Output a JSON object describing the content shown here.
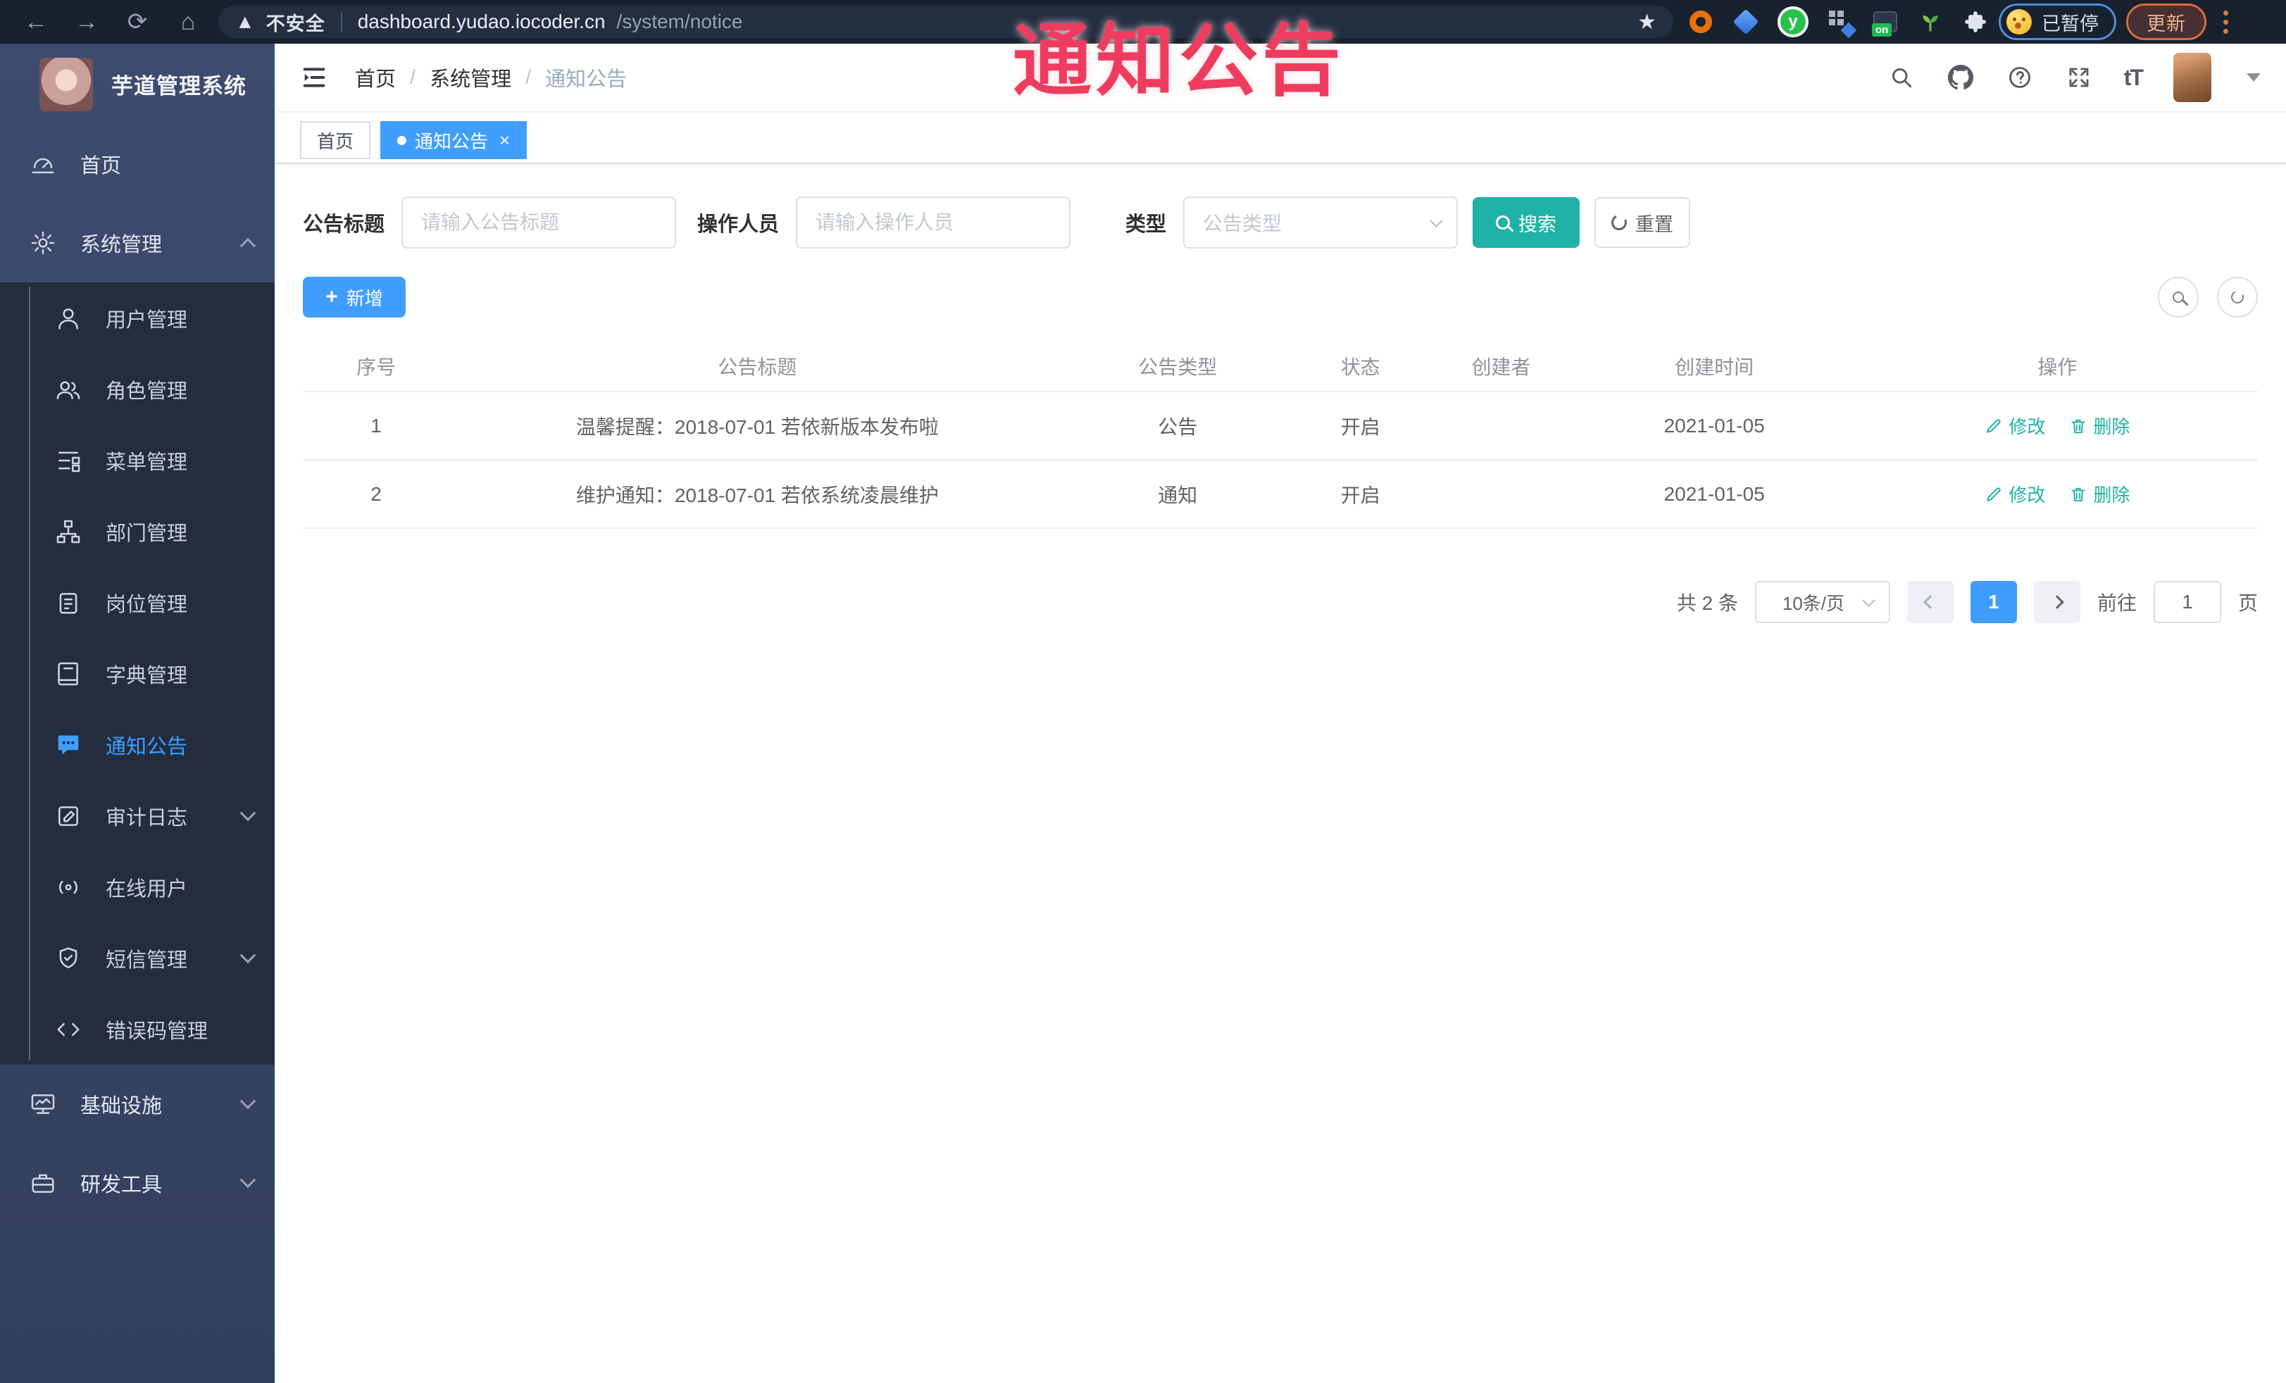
{
  "browser": {
    "security_label": "不安全",
    "url_host": "dashboard.yudao.iocoder.cn",
    "url_path": "/system/notice",
    "paused_badge": "已暂停",
    "update_button": "更新",
    "ext_y_letter": "y",
    "ext_on_badge": "on"
  },
  "watermark": "通知公告",
  "sidebar": {
    "app_title": "芋道管理系统",
    "items": {
      "home": {
        "label": "首页",
        "icon": "gauge-icon"
      },
      "system": {
        "label": "系统管理",
        "icon": "gear-icon"
      },
      "infra": {
        "label": "基础设施",
        "icon": "monitor-icon"
      },
      "devtools": {
        "label": "研发工具",
        "icon": "toolbox-icon"
      }
    },
    "submenu": [
      {
        "label": "用户管理",
        "icon": "user-icon"
      },
      {
        "label": "角色管理",
        "icon": "peoples-icon"
      },
      {
        "label": "菜单管理",
        "icon": "tree-table-icon"
      },
      {
        "label": "部门管理",
        "icon": "org-tree-icon"
      },
      {
        "label": "岗位管理",
        "icon": "post-icon"
      },
      {
        "label": "字典管理",
        "icon": "dict-icon"
      },
      {
        "label": "通知公告",
        "icon": "message-icon",
        "active": true
      },
      {
        "label": "审计日志",
        "icon": "log-icon"
      },
      {
        "label": "在线用户",
        "icon": "online-icon"
      },
      {
        "label": "短信管理",
        "icon": "shield-icon"
      },
      {
        "label": "错误码管理",
        "icon": "code-icon"
      }
    ]
  },
  "header": {
    "breadcrumb": [
      "首页",
      "系统管理",
      "通知公告"
    ],
    "fontsize_icon_text": "tT"
  },
  "tabs": [
    {
      "label": "首页"
    },
    {
      "label": "通知公告"
    }
  ],
  "filters": {
    "title_label": "公告标题",
    "title_placeholder": "请输入公告标题",
    "operator_label": "操作人员",
    "operator_placeholder": "请输入操作人员",
    "type_label": "类型",
    "type_placeholder": "公告类型",
    "search_label": "搜索",
    "reset_label": "重置"
  },
  "toolbar": {
    "add_label": "新增"
  },
  "table": {
    "columns": [
      "序号",
      "公告标题",
      "公告类型",
      "状态",
      "创建者",
      "创建时间",
      "操作"
    ],
    "rows": [
      {
        "index": "1",
        "title": "温馨提醒：2018-07-01 若依新版本发布啦",
        "type": "公告",
        "status": "开启",
        "creator": "",
        "create_time": "2021-01-05"
      },
      {
        "index": "2",
        "title": "维护通知：2018-07-01 若依系统凌晨维护",
        "type": "通知",
        "status": "开启",
        "creator": "",
        "create_time": "2021-01-05"
      }
    ],
    "actions": {
      "edit": "修改",
      "delete": "删除"
    }
  },
  "pagination": {
    "total_text": "共 2 条",
    "page_size": "10条/页",
    "current_page": "1",
    "goto_label": "前往",
    "goto_value": "1",
    "page_suffix": "页"
  },
  "colors": {
    "primary_blue": "#409eff",
    "theme_teal": "#1fb2a6",
    "watermark_pink": "#ee3c5f",
    "sidebar_bg": "#36436100",
    "submenu_bg": "#232d3e"
  }
}
